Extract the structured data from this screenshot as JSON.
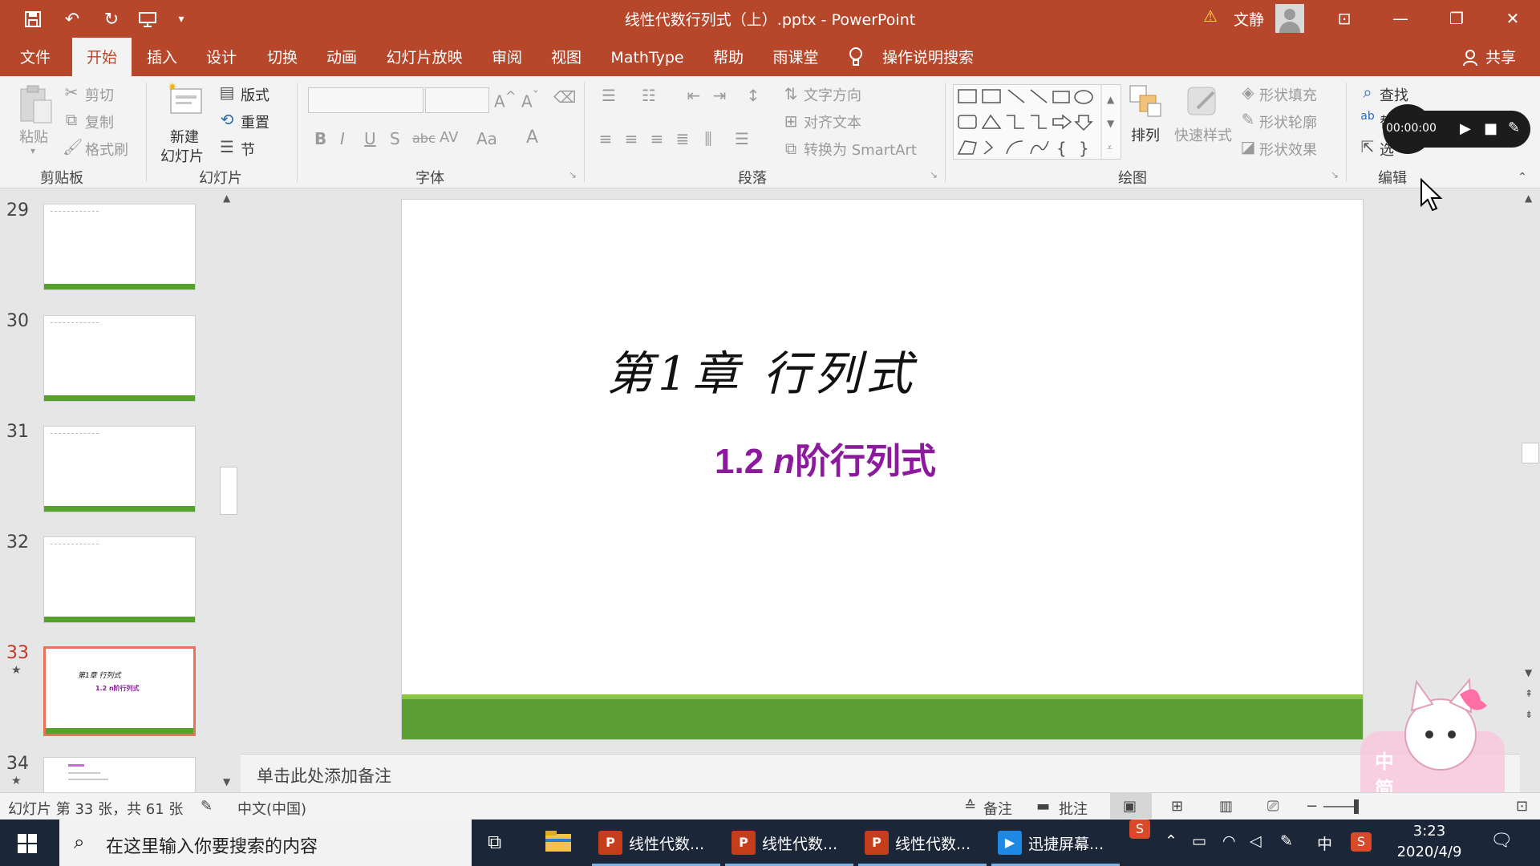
{
  "window": {
    "title": "线性代数行列式（上）.pptx  -  PowerPoint",
    "user": "文静"
  },
  "quick_access": [
    "save-icon",
    "undo-icon",
    "redo-icon",
    "present-from-start-icon",
    "customize-icon"
  ],
  "tabs": [
    "文件",
    "开始",
    "插入",
    "设计",
    "切换",
    "动画",
    "幻灯片放映",
    "审阅",
    "视图",
    "MathType",
    "帮助",
    "雨课堂",
    "操作说明搜索"
  ],
  "share_label": "共享",
  "ribbon": {
    "clipboard": {
      "paste": "粘贴",
      "cut": "剪切",
      "copy": "复制",
      "format_painter": "格式刷",
      "group": "剪贴板"
    },
    "slides": {
      "new_slide_line1": "新建",
      "new_slide_line2": "幻灯片",
      "layout": "版式",
      "reset": "重置",
      "section": "节",
      "group": "幻灯片"
    },
    "font": {
      "bold": "B",
      "italic": "I",
      "underline": "U",
      "strike": "S",
      "abc": "abc",
      "spacing": "AV",
      "case": "Aa",
      "color": "A",
      "group": "字体"
    },
    "paragraph": {
      "text_direction": "文字方向",
      "align_text": "对齐文本",
      "smartart": "转换为 SmartArt",
      "group": "段落"
    },
    "drawing": {
      "arrange": "排列",
      "quick_styles": "快速样式",
      "shape_fill": "形状填充",
      "shape_outline": "形状轮廓",
      "shape_effects": "形状效果",
      "group": "绘图"
    },
    "editing": {
      "find": "查找",
      "replace": "替",
      "select": "选",
      "group": "编辑"
    }
  },
  "recorder": {
    "time": "00:00:00"
  },
  "slides_panel": [
    {
      "number": "29",
      "star": ""
    },
    {
      "number": "30",
      "star": ""
    },
    {
      "number": "31",
      "star": ""
    },
    {
      "number": "32",
      "star": ""
    },
    {
      "number": "33",
      "star": "★",
      "active": true,
      "mini_title": "第1章  行列式",
      "mini_sub": "1.2  n阶行列式"
    },
    {
      "number": "34",
      "star": "★"
    }
  ],
  "slide": {
    "chapter": "第1章   行列式",
    "subtitle_num": "1.2",
    "subtitle_var": "n",
    "subtitle_text": "阶行列式"
  },
  "notes_placeholder": "单击此处添加备注",
  "status": {
    "slide_info": "幻灯片 第 33 张，共 61 张",
    "language": "中文(中国)",
    "notes": "备注",
    "comments": "批注"
  },
  "taskbar": {
    "search_placeholder": "在这里输入你要搜索的内容",
    "apps": [
      "线性代数...",
      "线性代数...",
      "线性代数...",
      "迅捷屏幕..."
    ],
    "ime": "中",
    "time": "3:23",
    "date": "2020/4/9"
  },
  "colors": {
    "accent": "#b7472a",
    "slide_band": "#5b9f35",
    "subtitle": "#8b1b9c"
  }
}
